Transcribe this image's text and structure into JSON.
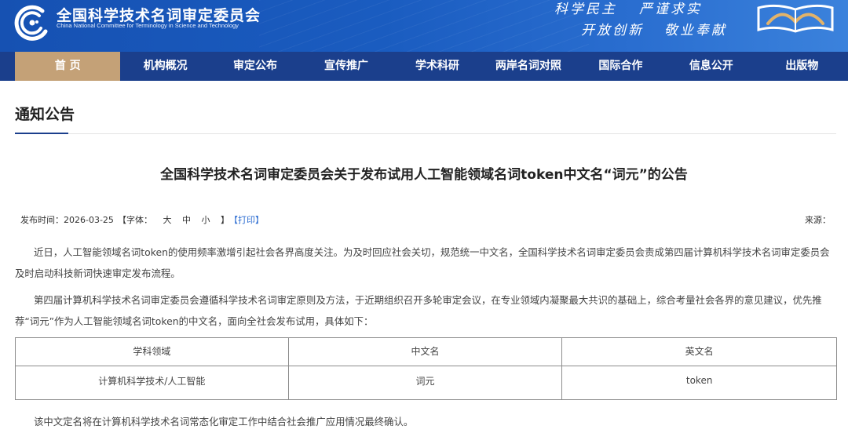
{
  "header": {
    "org_name_cn": "全国科学技术名词审定委员会",
    "org_name_en": "China National Committee for Terminology in Science and Technology",
    "motto": [
      "科学民主",
      "严谨求实",
      "开放创新",
      "敬业奉献"
    ],
    "colors": {
      "banner": "#1a5cc0",
      "nav": "#1b3f8c",
      "nav_active": "#c4a177",
      "link": "#2b6cd1"
    }
  },
  "nav": {
    "items": [
      "首 页",
      "机构概况",
      "审定公布",
      "宣传推广",
      "学术科研",
      "两岸名词对照",
      "国际合作",
      "信息公开",
      "出版物"
    ],
    "active_index": 0
  },
  "section": {
    "title": "通知公告"
  },
  "article": {
    "title": "全国科学技术名词审定委员会关于发布试用人工智能领域名词token中文名“词元”的公告",
    "meta": {
      "date": "发布时间：2026-03-25",
      "font_label": "【字体：",
      "font_sizes": [
        "大",
        "中",
        "小"
      ],
      "font_close": "】",
      "print": "【打印】",
      "source": "来源："
    },
    "paragraphs": [
      "近日，人工智能领域名词token的使用频率激增引起社会各界高度关注。为及时回应社会关切，规范统一中文名，全国科学技术名词审定委员会责成第四届计算机科学技术名词审定委员会及时启动科技新词快速审定发布流程。",
      "第四届计算机科学技术名词审定委员会遵循科学技术名词审定原则及方法，于近期组织召开多轮审定会议，在专业领域内凝聚最大共识的基础上，综合考量社会各界的意见建议，优先推荐“词元”作为人工智能领域名词token的中文名，面向全社会发布试用，具体如下：",
      "该中文定名将在计算机科学技术名词常态化审定工作中结合社会推广应用情况最终确认。"
    ],
    "table": {
      "headers": [
        "学科领域",
        "中文名",
        "英文名"
      ],
      "rows": [
        [
          "计算机科学技术/人工智能",
          "词元",
          "token"
        ]
      ]
    }
  }
}
